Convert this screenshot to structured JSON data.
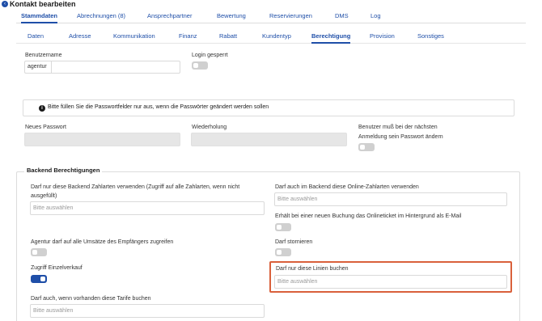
{
  "header": {
    "title": "Kontakt bearbeiten",
    "back_icon": "back-arrow-icon"
  },
  "tabs": [
    {
      "label": "Stammdaten",
      "active": true
    },
    {
      "label": "Abrechnungen (8)",
      "active": false
    },
    {
      "label": "Ansprechpartner",
      "active": false
    },
    {
      "label": "Bewertung",
      "active": false
    },
    {
      "label": "Reservierungen",
      "active": false
    },
    {
      "label": "DMS",
      "active": false
    },
    {
      "label": "Log",
      "active": false
    }
  ],
  "subtabs": [
    {
      "label": "Daten",
      "active": false
    },
    {
      "label": "Adresse",
      "active": false
    },
    {
      "label": "Kommunikation",
      "active": false
    },
    {
      "label": "Finanz",
      "active": false
    },
    {
      "label": "Rabatt",
      "active": false
    },
    {
      "label": "Kundentyp",
      "active": false
    },
    {
      "label": "Berechtigung",
      "active": true
    },
    {
      "label": "Provision",
      "active": false
    },
    {
      "label": "Sonstiges",
      "active": false
    }
  ],
  "form": {
    "username_label": "Benutzername",
    "username_prefix": "agentur",
    "username_value": "",
    "login_locked_label": "Login gesperrt",
    "login_locked": false,
    "info_text": "Bitte füllen Sie die Passwortfelder nur aus, wenn die Passwörter geändert werden sollen",
    "new_password_label": "Neues Passwort",
    "repeat_label": "Wiederholung",
    "force_change_label_1": "Benutzer muß bei der nächsten",
    "force_change_label_2": "Anmeldung sein Passwort ändern",
    "force_change": false
  },
  "backend": {
    "legend": "Backend Berechtigungen",
    "zahlarten_label_1": "Darf nur diese Backend Zahlarten verwenden (Zugriff auf alle Zahlarten, wenn nicht",
    "zahlarten_label_2": "ausgefüllt)",
    "zahlarten_placeholder": "Bitte auswählen",
    "online_zahlarten_label": "Darf auch im Backend diese Online-Zahlarten verwenden",
    "online_zahlarten_placeholder": "Bitte auswählen",
    "onlineticket_label": "Erhält bei einer neuen Buchung das Onlineticket im Hintergrund als E-Mail",
    "onlineticket": false,
    "umsaetze_label": "Agentur darf auf alle Umsätze des Empfängers zugreifen",
    "umsaetze": false,
    "stornieren_label": "Darf stornieren",
    "stornieren": false,
    "einzelverkauf_label": "Zugriff Einzelverkauf",
    "einzelverkauf": true,
    "linien_label": "Darf nur diese Linien buchen",
    "linien_placeholder": "Bitte auswählen",
    "tarife_label": "Darf auch, wenn vorhanden diese Tarife buchen",
    "tarife_placeholder": "Bitte auswählen"
  },
  "colors": {
    "accent": "#1f4fa8",
    "highlight": "#d9603b"
  }
}
